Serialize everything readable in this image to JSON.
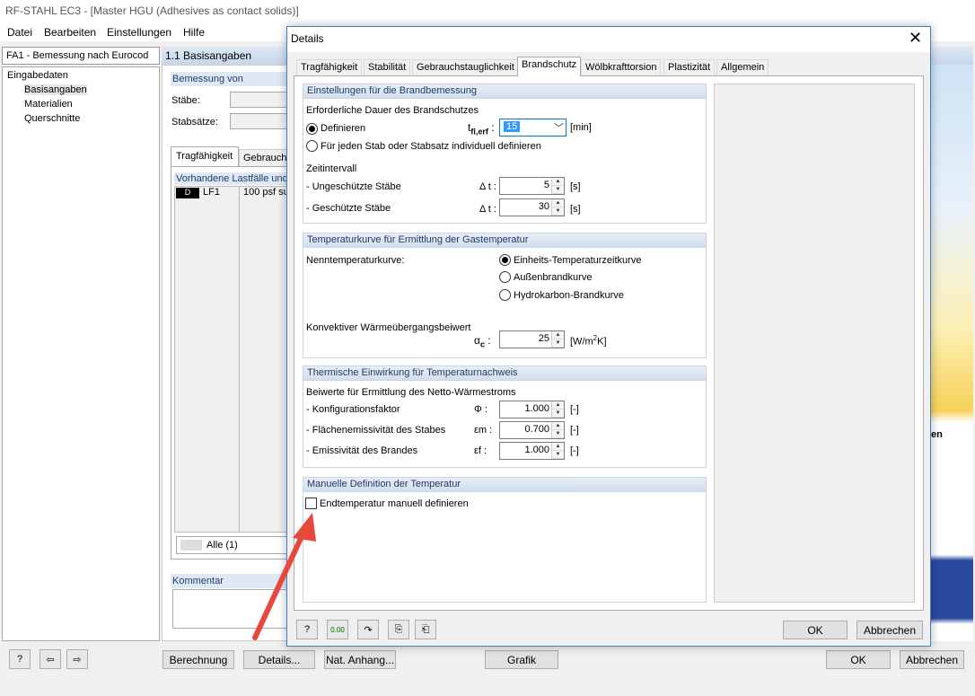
{
  "app": {
    "title": "RF-STAHL EC3 - [Master HGU (Adhesives as contact solids)]",
    "menu": [
      "Datei",
      "Bearbeiten",
      "Einstellungen",
      "Hilfe"
    ],
    "case_select": "FA1 - Bemessung nach Eurocod",
    "tree": {
      "root": "Eingabedaten",
      "items": [
        "Basisangaben",
        "Materialien",
        "Querschnitte"
      ]
    },
    "page_title": "1.1 Basisangaben",
    "bemessung_von": "Bemessung von",
    "staebe_label": "Stäbe:",
    "stabsaetze_label": "Stabsätze:",
    "tabs": [
      "Tragfähigkeit",
      "Gebrauchs"
    ],
    "lastfaelle_header": "Vorhandene Lastfälle und",
    "lastfall": {
      "badge": "D",
      "id": "LF1",
      "desc": "100 psf su"
    },
    "alle": "Alle (1)",
    "kommentar": "Kommentar",
    "bottom_buttons": {
      "berechnung": "Berechnung",
      "details": "Details...",
      "anhang": "Nat. Anhang...",
      "grafik": "Grafik",
      "ok": "OK",
      "abbrechen": "Abbrechen"
    },
    "side_fragment": "en"
  },
  "dialog": {
    "title": "Details",
    "tabs": [
      "Tragfähigkeit",
      "Stabilität",
      "Gebrauchstauglichkeit",
      "Brandschutz",
      "Wölbkrafttorsion",
      "Plastizität",
      "Allgemein"
    ],
    "active_tab": "Brandschutz",
    "s1": {
      "header": "Einstellungen für die Brandbemessung",
      "dauer_label": "Erforderliche Dauer des Brandschutzes",
      "radio_def": "Definieren",
      "radio_ind": "Für jeden Stab oder Stabsatz individuell definieren",
      "tfi_symbol": "t",
      "tfi_sub": "fi,erf",
      "tfi_colon": ":",
      "tfi_value": "15",
      "tfi_unit": "[min]",
      "zeitintervall": "Zeitintervall",
      "ungeschuetzt": "- Ungeschützte Stäbe",
      "geschuetzt": "- Geschützte Stäbe",
      "delta_label": "Δ t :",
      "ungeschuetzt_val": "5",
      "geschuetzt_val": "30",
      "s_unit": "[s]"
    },
    "s2": {
      "header": "Temperaturkurve für Ermittlung der Gastemperatur",
      "nenn": "Nenntemperaturkurve:",
      "opt1": "Einheits-Temperaturzeitkurve",
      "opt2": "Außenbrandkurve",
      "opt3": "Hydrokarbon-Brandkurve",
      "konvektiv": "Konvektiver Wärmeübergangsbeiwert",
      "alpha_symbol": "α",
      "alpha_sub": "c",
      "alpha_colon": ":",
      "alpha_val": "25",
      "alpha_unit_pre": "[W/m",
      "alpha_unit_sup": "2",
      "alpha_unit_post": "K]"
    },
    "s3": {
      "header": "Thermische Einwirkung für Temperaturnachweis",
      "beiwerte": "Beiwerte für Ermittlung des Netto-Wärmestroms",
      "konfig": "- Konfigurationsfaktor",
      "konfig_sym": "Φ :",
      "konfig_val": "1.000",
      "flaechen": "- Flächenemissivität des Stabes",
      "flaechen_sym": "εm :",
      "flaechen_val": "0.700",
      "brand": "- Emissivität des Brandes",
      "brand_sym": "εf :",
      "brand_val": "1.000",
      "unit": "[-]"
    },
    "s4": {
      "header": "Manuelle Definition der Temperatur",
      "checkbox": "Endtemperatur manuell definieren"
    },
    "buttons": {
      "ok": "OK",
      "abbrechen": "Abbrechen"
    }
  },
  "colors": {
    "accent": "#0078d7",
    "arrow": "#e8483c",
    "section_head": "#d3deec"
  }
}
